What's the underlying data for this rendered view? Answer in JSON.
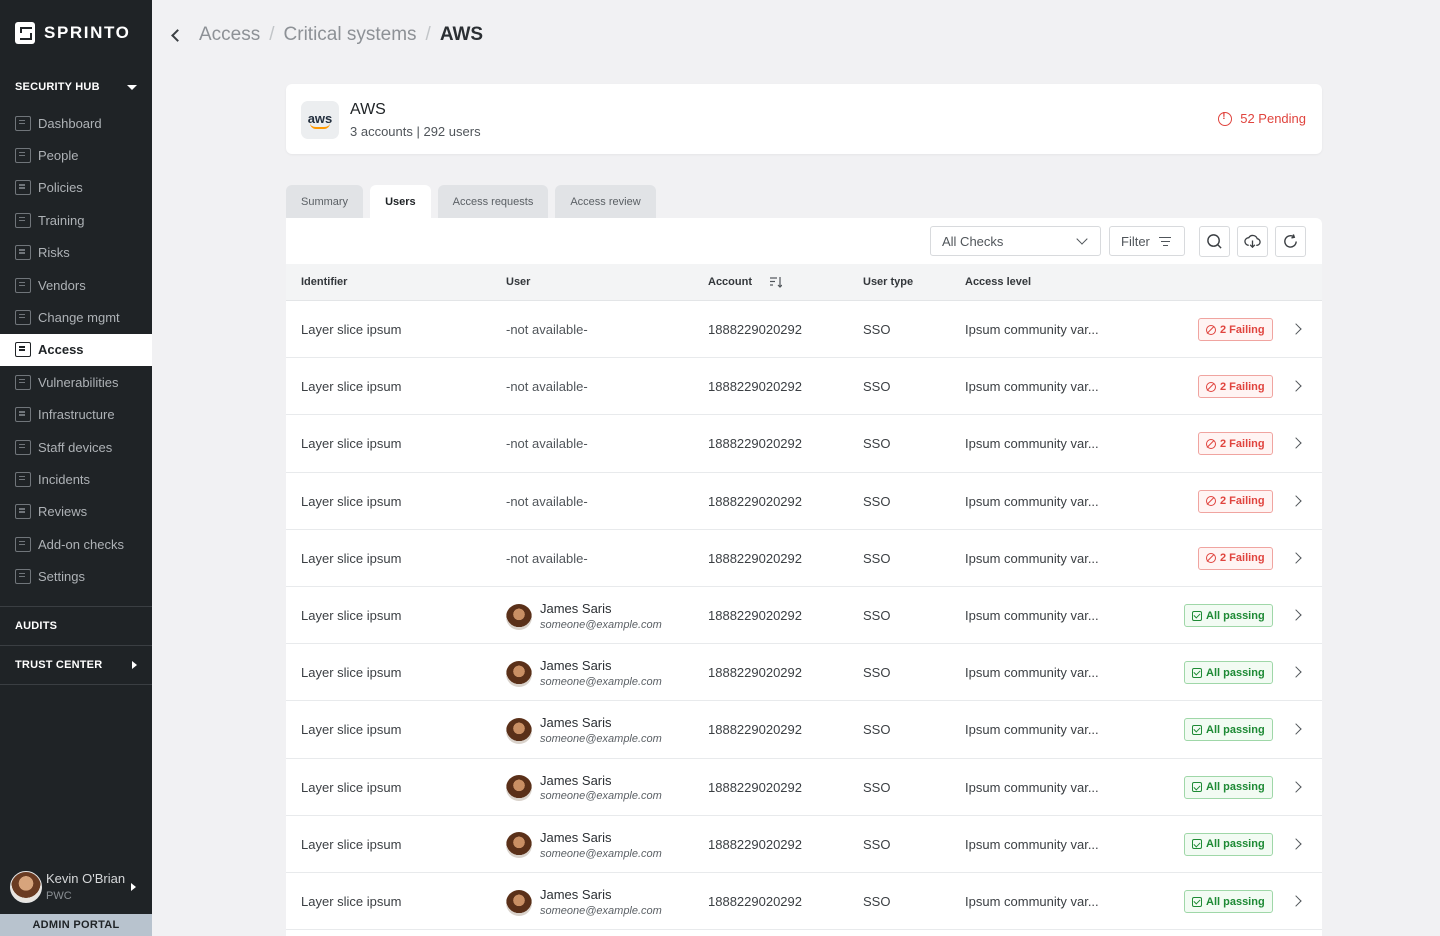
{
  "app": {
    "brand": "SPRINTO"
  },
  "sidebar": {
    "security_hub": "SECURITY HUB",
    "items": [
      {
        "label": "Dashboard",
        "icon": "dashboard-icon"
      },
      {
        "label": "People",
        "icon": "people-icon"
      },
      {
        "label": "Policies",
        "icon": "policies-icon"
      },
      {
        "label": "Training",
        "icon": "training-icon"
      },
      {
        "label": "Risks",
        "icon": "risks-icon"
      },
      {
        "label": "Vendors",
        "icon": "vendors-icon"
      },
      {
        "label": "Change mgmt",
        "icon": "change-mgmt-icon"
      },
      {
        "label": "Access",
        "icon": "access-icon",
        "active": true
      },
      {
        "label": "Vulnerabilities",
        "icon": "vulnerabilities-icon"
      },
      {
        "label": "Infrastructure",
        "icon": "infrastructure-icon"
      },
      {
        "label": "Staff devices",
        "icon": "staff-devices-icon"
      },
      {
        "label": "Incidents",
        "icon": "incidents-icon"
      },
      {
        "label": "Reviews",
        "icon": "reviews-icon"
      },
      {
        "label": "Add-on checks",
        "icon": "add-on-checks-icon"
      },
      {
        "label": "Settings",
        "icon": "settings-icon"
      }
    ],
    "audits": "AUDITS",
    "trust_center": "TRUST CENTER",
    "profile": {
      "name": "Kevin O'Brian",
      "org": "PWC"
    },
    "admin_portal": "ADMIN PORTAL"
  },
  "breadcrumb": {
    "items": [
      "Access",
      "Critical systems"
    ],
    "current": "AWS"
  },
  "header": {
    "logo_text": "aws",
    "title": "AWS",
    "subtitle": "3 accounts | 292 users",
    "pending": "52 Pending"
  },
  "tabs": [
    {
      "label": "Summary"
    },
    {
      "label": "Users",
      "active": true
    },
    {
      "label": "Access requests"
    },
    {
      "label": "Access review"
    }
  ],
  "toolbar": {
    "checks_select": "All Checks",
    "filter": "Filter"
  },
  "table": {
    "columns": [
      "Identifier",
      "User",
      "Account",
      "User type",
      "Access level"
    ],
    "rows": [
      {
        "identifier": "Layer slice ipsum",
        "user": "-not available-",
        "account": "1888229020292",
        "user_type": "SSO",
        "access_level": "Ipsum community var...",
        "status": "2 Failing",
        "status_type": "fail"
      },
      {
        "identifier": "Layer slice ipsum",
        "user": "-not available-",
        "account": "1888229020292",
        "user_type": "SSO",
        "access_level": "Ipsum community var...",
        "status": "2 Failing",
        "status_type": "fail"
      },
      {
        "identifier": "Layer slice ipsum",
        "user": "-not available-",
        "account": "1888229020292",
        "user_type": "SSO",
        "access_level": "Ipsum community var...",
        "status": "2 Failing",
        "status_type": "fail"
      },
      {
        "identifier": "Layer slice ipsum",
        "user": "-not available-",
        "account": "1888229020292",
        "user_type": "SSO",
        "access_level": "Ipsum community var...",
        "status": "2 Failing",
        "status_type": "fail"
      },
      {
        "identifier": "Layer slice ipsum",
        "user": "-not available-",
        "account": "1888229020292",
        "user_type": "SSO",
        "access_level": "Ipsum community var...",
        "status": "2 Failing",
        "status_type": "fail"
      },
      {
        "identifier": "Layer slice ipsum",
        "user_name": "James Saris",
        "user_email": "someone@example.com",
        "account": "1888229020292",
        "user_type": "SSO",
        "access_level": "Ipsum community var...",
        "status": "All passing",
        "status_type": "pass"
      },
      {
        "identifier": "Layer slice ipsum",
        "user_name": "James Saris",
        "user_email": "someone@example.com",
        "account": "1888229020292",
        "user_type": "SSO",
        "access_level": "Ipsum community var...",
        "status": "All passing",
        "status_type": "pass"
      },
      {
        "identifier": "Layer slice ipsum",
        "user_name": "James Saris",
        "user_email": "someone@example.com",
        "account": "1888229020292",
        "user_type": "SSO",
        "access_level": "Ipsum community var...",
        "status": "All passing",
        "status_type": "pass"
      },
      {
        "identifier": "Layer slice ipsum",
        "user_name": "James Saris",
        "user_email": "someone@example.com",
        "account": "1888229020292",
        "user_type": "SSO",
        "access_level": "Ipsum community var...",
        "status": "All passing",
        "status_type": "pass"
      },
      {
        "identifier": "Layer slice ipsum",
        "user_name": "James Saris",
        "user_email": "someone@example.com",
        "account": "1888229020292",
        "user_type": "SSO",
        "access_level": "Ipsum community var...",
        "status": "All passing",
        "status_type": "pass"
      },
      {
        "identifier": "Layer slice ipsum",
        "user_name": "James Saris",
        "user_email": "someone@example.com",
        "account": "1888229020292",
        "user_type": "SSO",
        "access_level": "Ipsum community var...",
        "status": "All passing",
        "status_type": "pass"
      }
    ]
  },
  "colors": {
    "sidebar_bg": "#1f2326",
    "fail": "#e0443e",
    "pass": "#1e8a35",
    "admin_bar": "#b8c3ce"
  }
}
